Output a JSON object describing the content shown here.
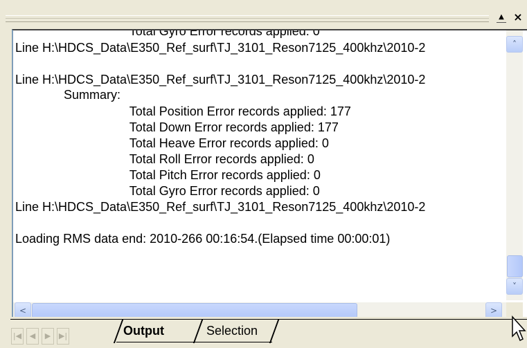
{
  "titlebar": {
    "menu_glyph": "▲",
    "close_glyph": "×"
  },
  "output_lines": [
    "                                 Total Gyro Error records applied: 0",
    "Line H:\\HDCS_Data\\E350_Ref_surf\\TJ_3101_Reson7125_400khz\\2010-2",
    "",
    "Line H:\\HDCS_Data\\E350_Ref_surf\\TJ_3101_Reson7125_400khz\\2010-2",
    "              Summary:",
    "                                 Total Position Error records applied: 177",
    "                                 Total Down Error records applied: 177",
    "                                 Total Heave Error records applied: 0",
    "                                 Total Roll Error records applied: 0",
    "                                 Total Pitch Error records applied: 0",
    "                                 Total Gyro Error records applied: 0",
    "Line H:\\HDCS_Data\\E350_Ref_surf\\TJ_3101_Reson7125_400khz\\2010-2",
    "",
    "Loading RMS data end: 2010-266 00:16:54.(Elapsed time 00:00:01)"
  ],
  "scroll": {
    "up_glyph": "˄",
    "down_glyph": "˅",
    "left_glyph": "<",
    "right_glyph": ">"
  },
  "nav": {
    "first": "|◀",
    "prev": "◀",
    "next": "▶",
    "last": "▶|"
  },
  "tabs": [
    {
      "label": "Output",
      "active": true
    },
    {
      "label": "Selection",
      "active": false
    }
  ]
}
